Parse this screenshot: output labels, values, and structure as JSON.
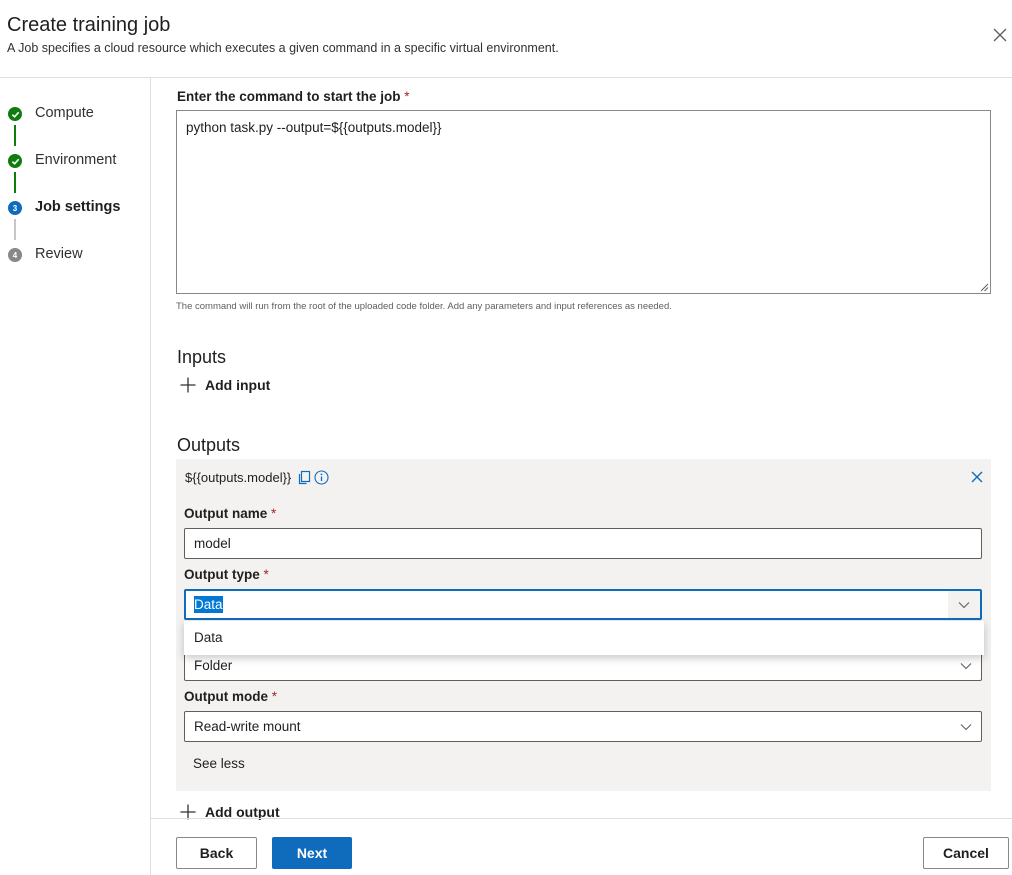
{
  "header": {
    "title": "Create training job",
    "subtitle": "A Job specifies a cloud resource which executes a given command in a specific virtual environment."
  },
  "steps": [
    {
      "label": "Compute",
      "number": "1",
      "state": "done"
    },
    {
      "label": "Environment",
      "number": "2",
      "state": "done"
    },
    {
      "label": "Job settings",
      "number": "3",
      "state": "current"
    },
    {
      "label": "Review",
      "number": "4",
      "state": "future"
    }
  ],
  "command": {
    "label": "Enter the command to start the job",
    "required_mark": "*",
    "value": "python task.py --output=${{outputs.model}}",
    "hint": "The command will run from the root of the uploaded code folder. Add any parameters and input references as needed."
  },
  "inputs": {
    "title": "Inputs",
    "add_label": "Add input"
  },
  "outputs": {
    "title": "Outputs",
    "reference": "${{outputs.model}}",
    "name_label": "Output name",
    "name_value": "model",
    "type_label": "Output type",
    "type_value": "Data",
    "type_options": [
      "Data"
    ],
    "format_value": "Folder",
    "mode_label": "Output mode",
    "mode_value": "Read-write mount",
    "see_less": "See less",
    "add_label": "Add output",
    "required_mark": "*"
  },
  "footer": {
    "back_label": "Back",
    "next_label": "Next",
    "cancel_label": "Cancel"
  },
  "colors": {
    "accent": "#0f6cbd",
    "success": "#107c10",
    "required": "#a4262c"
  }
}
